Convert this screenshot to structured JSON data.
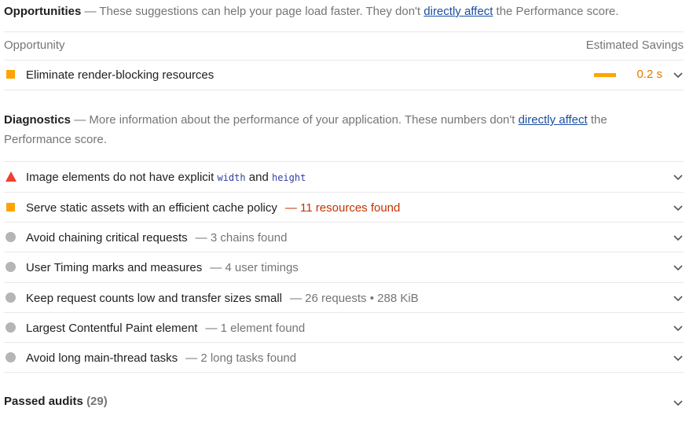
{
  "opportunities": {
    "heading": "Opportunities",
    "desc_before": " — These suggestions can help your page load faster. They don't ",
    "link_text": "directly affect",
    "desc_after": " the Performance score.",
    "col_opportunity": "Opportunity",
    "col_savings": "Estimated Savings",
    "items": [
      {
        "title": "Eliminate render-blocking resources",
        "savings": "0.2 s",
        "icon": "square-icon",
        "color": "#ffa400"
      }
    ]
  },
  "diagnostics": {
    "heading": "Diagnostics",
    "desc_before": " — More information about the performance of your application. These numbers don't ",
    "link_text": "directly affect",
    "desc_after": " the Performance score.",
    "items": [
      {
        "title_before": "Image elements do not have explicit ",
        "code1": "width",
        "and_text": " and ",
        "code2": "height",
        "detail": "",
        "icon": "triangle-icon"
      },
      {
        "title": "Serve static assets with an efficient cache policy",
        "detail": "— 11 resources found",
        "icon": "square-icon"
      },
      {
        "title": "Avoid chaining critical requests",
        "detail": "— 3 chains found",
        "icon": "circle-icon"
      },
      {
        "title": "User Timing marks and measures",
        "detail": "— 4 user timings",
        "icon": "circle-icon"
      },
      {
        "title": "Keep request counts low and transfer sizes small",
        "detail": "— 26 requests • 288 KiB",
        "icon": "circle-icon"
      },
      {
        "title": "Largest Contentful Paint element",
        "detail": "— 1 element found",
        "icon": "circle-icon"
      },
      {
        "title": "Avoid long main-thread tasks",
        "detail": "— 2 long tasks found",
        "icon": "circle-icon"
      }
    ]
  },
  "passed": {
    "label": "Passed audits",
    "count": "(29)"
  },
  "colors": {
    "fail": "#f33f2f",
    "average": "#ffa400",
    "informative": "#b5b5b5",
    "link": "#1a4ea1"
  }
}
